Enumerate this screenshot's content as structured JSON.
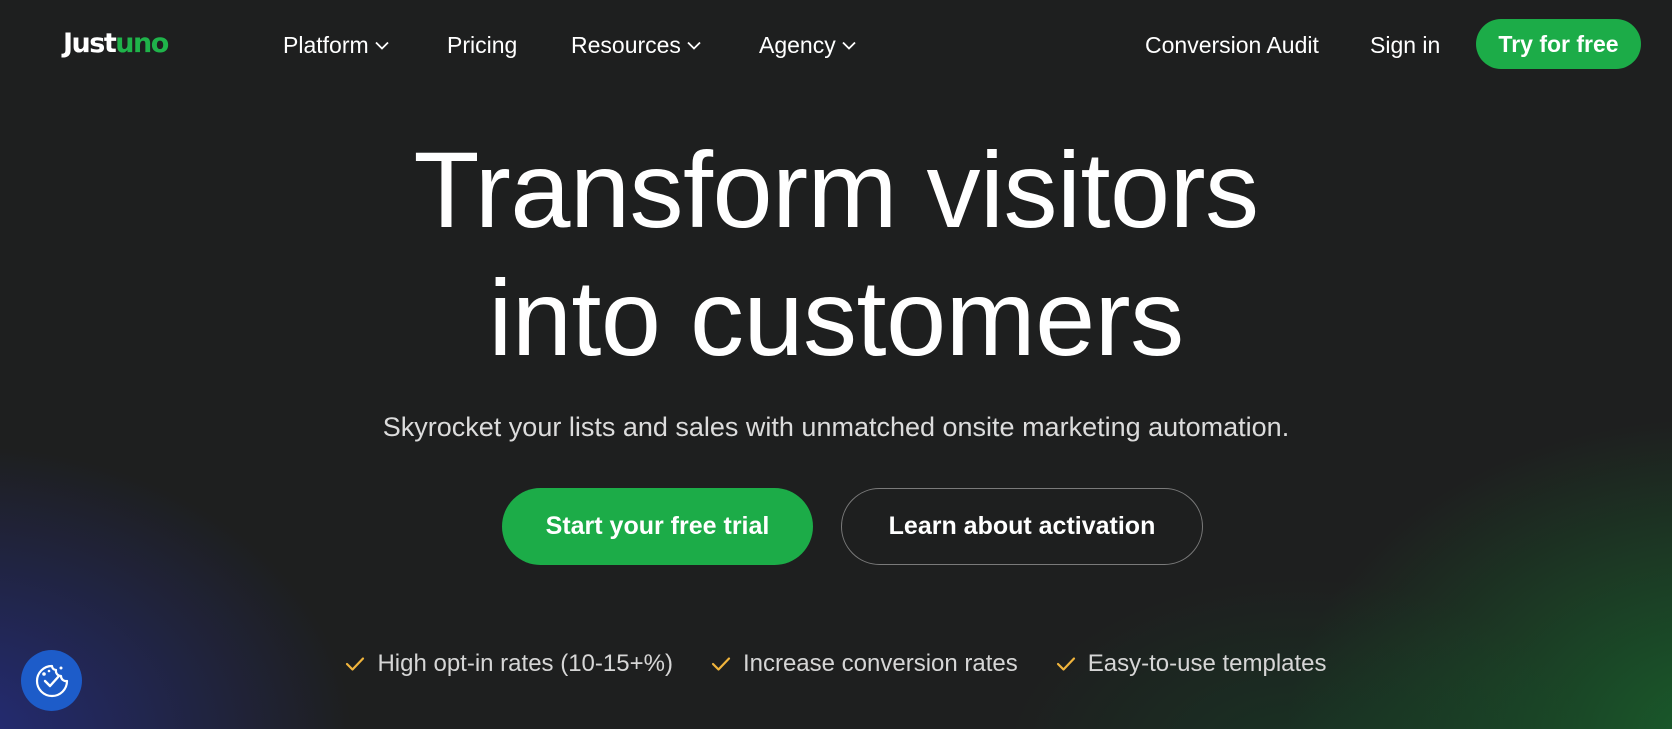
{
  "logo": {
    "part1": "Just",
    "part2": "uno"
  },
  "nav": {
    "platform": "Platform",
    "pricing": "Pricing",
    "resources": "Resources",
    "agency": "Agency",
    "conversion_audit": "Conversion Audit",
    "sign_in": "Sign in",
    "try_free": "Try for free"
  },
  "hero": {
    "headline_line1": "Transform visitors",
    "headline_line2": "into customers",
    "subhead": "Skyrocket your lists and sales with unmatched onsite marketing automation.",
    "cta_primary": "Start your free trial",
    "cta_secondary": "Learn about activation"
  },
  "features": [
    {
      "label": "High opt-in rates (10-15+%)",
      "icon": "check-icon"
    },
    {
      "label": "Increase conversion rates",
      "icon": "check-icon"
    },
    {
      "label": "Easy-to-use templates",
      "icon": "check-icon"
    }
  ],
  "cookie_button": {
    "icon": "cookie-consent-icon"
  },
  "colors": {
    "brand_green": "#1cac48",
    "background": "#1e1f1f",
    "check_color": "#f0b43c",
    "cookie_blue": "#1d5cc9"
  }
}
